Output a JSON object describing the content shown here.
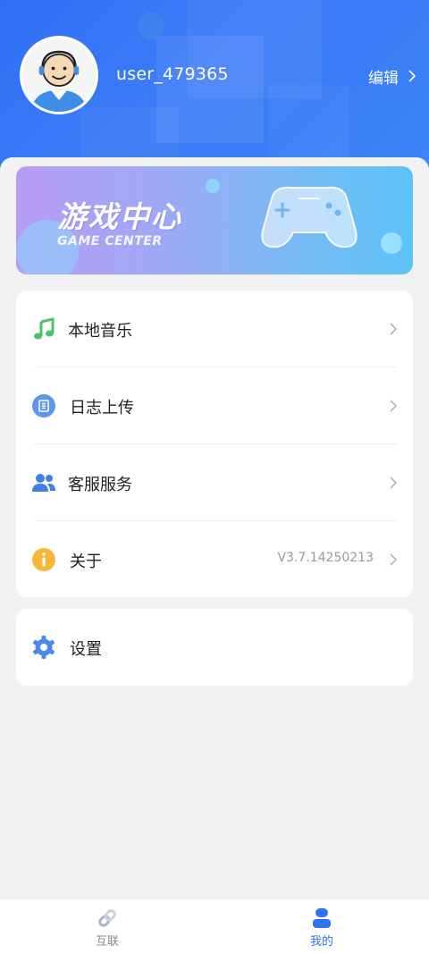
{
  "profile": {
    "username": "user_479365",
    "edit_label": "编辑"
  },
  "banner": {
    "title": "游戏中心",
    "subtitle": "GAME CENTER"
  },
  "menu": [
    {
      "label": "本地音乐",
      "icon": "music-note-icon"
    },
    {
      "label": "日志上传",
      "icon": "log-upload-icon"
    },
    {
      "label": "客服服务",
      "icon": "customer-service-icon"
    },
    {
      "label": "关于",
      "icon": "info-icon",
      "value": "V3.7.14250213"
    }
  ],
  "settings": {
    "label": "设置",
    "icon": "gear-icon"
  },
  "tabs": [
    {
      "label": "互联",
      "icon": "link-icon",
      "active": false
    },
    {
      "label": "我的",
      "icon": "profile-icon",
      "active": true
    }
  ],
  "colors": {
    "accent": "#2f73f3",
    "music": "#4cc26a",
    "info": "#f6b73c"
  }
}
